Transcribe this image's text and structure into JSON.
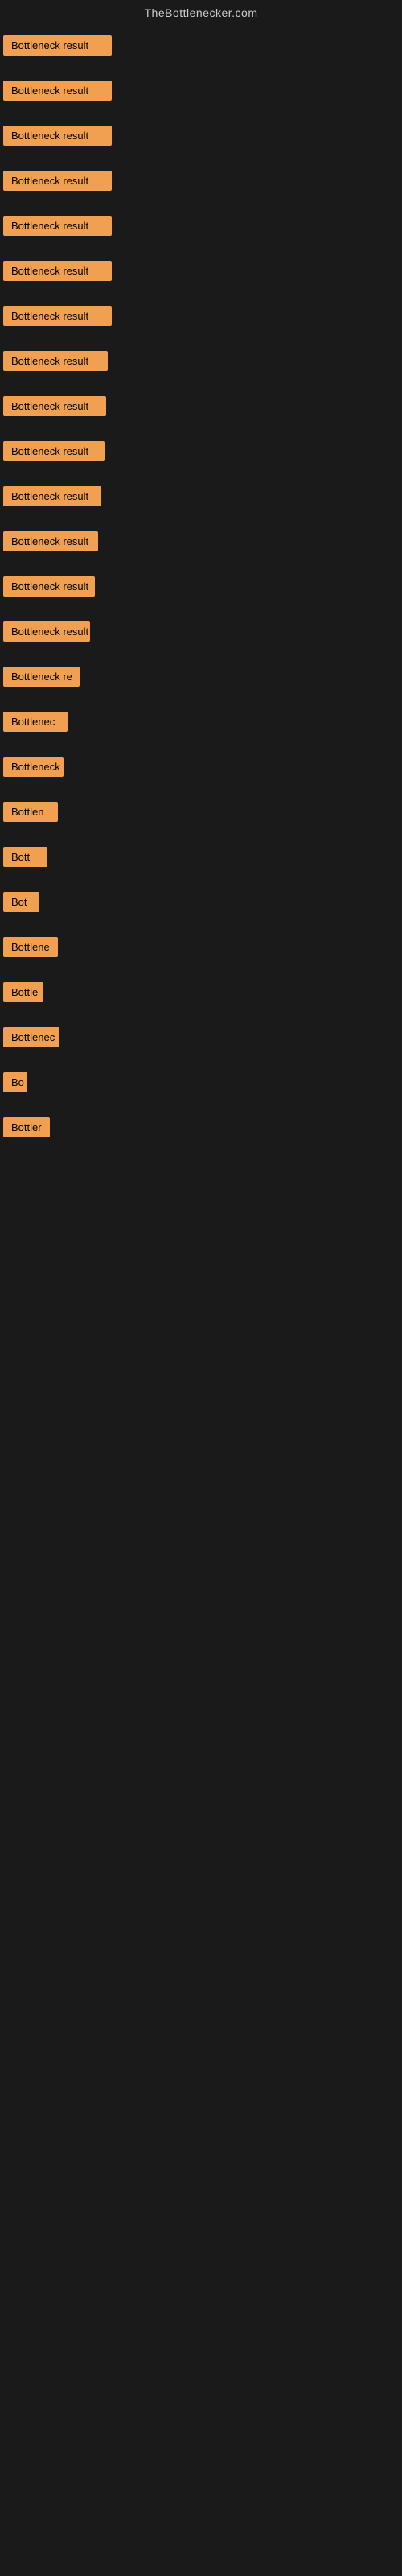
{
  "site": {
    "title": "TheBottlenecker.com"
  },
  "colors": {
    "badge_bg": "#f0a050",
    "badge_text": "#000000",
    "page_bg": "#1a1a1a",
    "site_title": "#cccccc"
  },
  "rows": [
    {
      "id": 1,
      "label": "Bottleneck result",
      "width": 135
    },
    {
      "id": 2,
      "label": "Bottleneck result",
      "width": 135
    },
    {
      "id": 3,
      "label": "Bottleneck result",
      "width": 135
    },
    {
      "id": 4,
      "label": "Bottleneck result",
      "width": 135
    },
    {
      "id": 5,
      "label": "Bottleneck result",
      "width": 135
    },
    {
      "id": 6,
      "label": "Bottleneck result",
      "width": 135
    },
    {
      "id": 7,
      "label": "Bottleneck result",
      "width": 135
    },
    {
      "id": 8,
      "label": "Bottleneck result",
      "width": 130
    },
    {
      "id": 9,
      "label": "Bottleneck result",
      "width": 128
    },
    {
      "id": 10,
      "label": "Bottleneck result",
      "width": 126
    },
    {
      "id": 11,
      "label": "Bottleneck result",
      "width": 122
    },
    {
      "id": 12,
      "label": "Bottleneck result",
      "width": 118
    },
    {
      "id": 13,
      "label": "Bottleneck result",
      "width": 114
    },
    {
      "id": 14,
      "label": "Bottleneck result",
      "width": 108
    },
    {
      "id": 15,
      "label": "Bottleneck re",
      "width": 95
    },
    {
      "id": 16,
      "label": "Bottlenec",
      "width": 80
    },
    {
      "id": 17,
      "label": "Bottleneck r",
      "width": 75
    },
    {
      "id": 18,
      "label": "Bottlen",
      "width": 68
    },
    {
      "id": 19,
      "label": "Bott",
      "width": 55
    },
    {
      "id": 20,
      "label": "Bot",
      "width": 45
    },
    {
      "id": 21,
      "label": "Bottlene",
      "width": 68
    },
    {
      "id": 22,
      "label": "Bottle",
      "width": 50
    },
    {
      "id": 23,
      "label": "Bottlenec",
      "width": 70
    },
    {
      "id": 24,
      "label": "Bo",
      "width": 30
    },
    {
      "id": 25,
      "label": "Bottler",
      "width": 58
    }
  ]
}
